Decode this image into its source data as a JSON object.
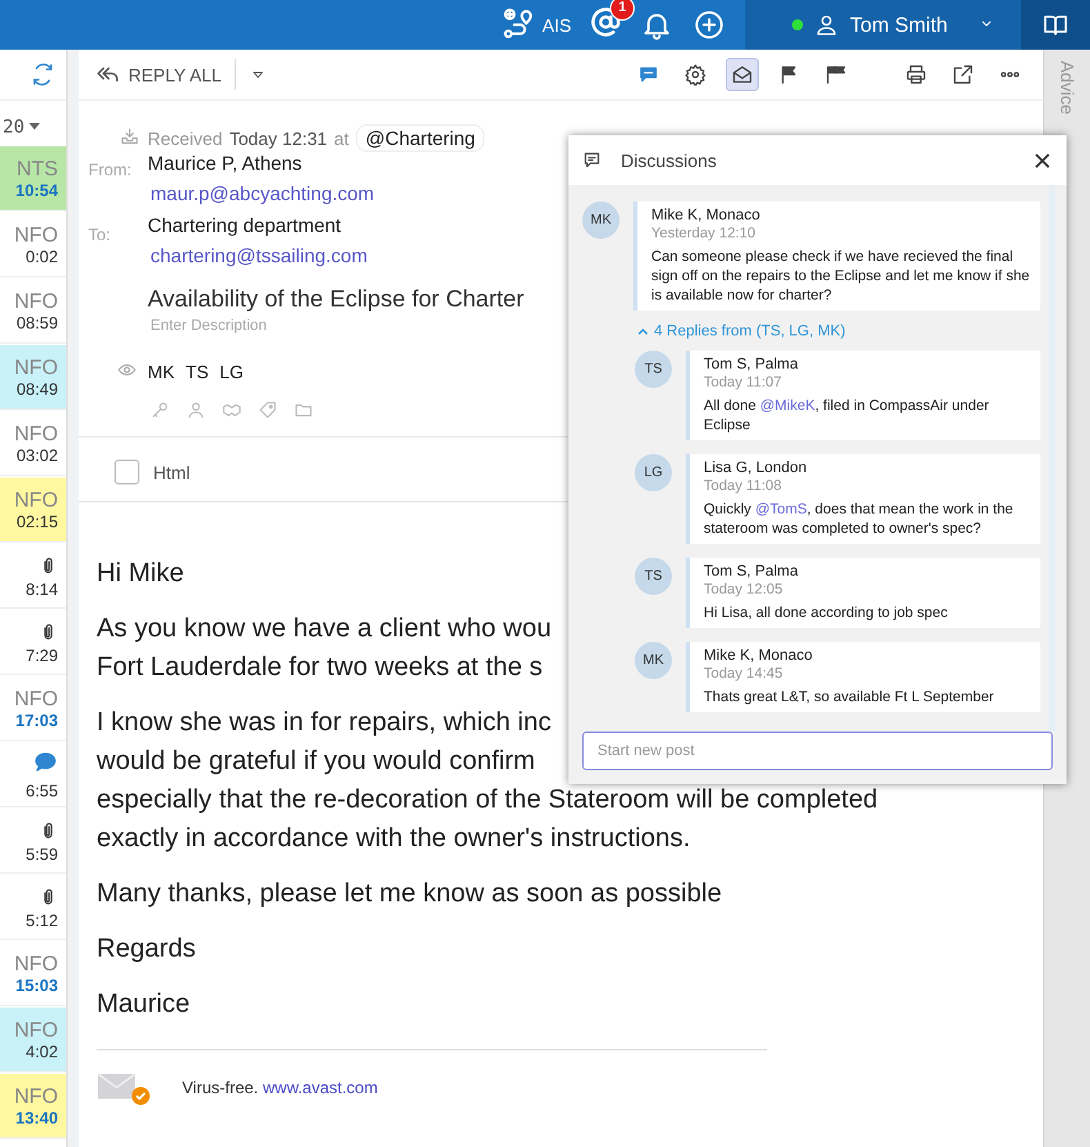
{
  "top_bar": {
    "ais_label": "AIS",
    "mentions_badge": "1",
    "user_name": "Tom Smith",
    "online": true
  },
  "message_list": {
    "year_selector": "20",
    "items": [
      {
        "kind": "label",
        "label": "NTS",
        "time": "10:54",
        "unread": true,
        "color": "#b7e6a6"
      },
      {
        "kind": "label",
        "label": "NFO",
        "time": "0:02",
        "unread": false,
        "color": "#ffffff"
      },
      {
        "kind": "label",
        "label": "NFO",
        "time": "08:59",
        "unread": false,
        "color": "#ffffff"
      },
      {
        "kind": "label",
        "label": "NFO",
        "time": "08:49",
        "unread": false,
        "color": "#c8f1f8"
      },
      {
        "kind": "label",
        "label": "NFO",
        "time": "03:02",
        "unread": false,
        "color": "#ffffff"
      },
      {
        "kind": "label",
        "label": "NFO",
        "time": "02:15",
        "unread": false,
        "color": "#fff8a0"
      },
      {
        "kind": "attachment",
        "time": "8:14",
        "unread": false,
        "color": "#ffffff"
      },
      {
        "kind": "attachment",
        "time": "7:29",
        "unread": false,
        "color": "#ffffff"
      },
      {
        "kind": "label",
        "label": "NFO",
        "time": "17:03",
        "unread": true,
        "color": "#ffffff"
      },
      {
        "kind": "chat",
        "time": "6:55",
        "unread": false,
        "color": "#ffffff"
      },
      {
        "kind": "attachment",
        "time": "5:59",
        "unread": false,
        "color": "#ffffff"
      },
      {
        "kind": "attachment",
        "time": "5:12",
        "unread": false,
        "color": "#ffffff"
      },
      {
        "kind": "label",
        "label": "NFO",
        "time": "15:03",
        "unread": true,
        "color": "#ffffff"
      },
      {
        "kind": "label",
        "label": "NFO",
        "time": "4:02",
        "unread": false,
        "color": "#c8f1f8"
      },
      {
        "kind": "label",
        "label": "NFO",
        "time": "13:40",
        "unread": true,
        "color": "#fff8a0"
      }
    ]
  },
  "toolbar": {
    "reply_all_label": "REPLY ALL",
    "buttons": [
      {
        "kind": "chat",
        "selected": false
      },
      {
        "kind": "settings",
        "selected": false
      },
      {
        "kind": "envelope",
        "selected": true
      },
      {
        "kind": "flag",
        "selected": false
      },
      {
        "kind": "flags",
        "selected": false
      },
      {
        "kind": "print",
        "selected": false
      },
      {
        "kind": "edit",
        "selected": false
      },
      {
        "kind": "more",
        "selected": false
      }
    ]
  },
  "email": {
    "received_label": "Received",
    "received_time": "Today 12:31",
    "at_label": "at",
    "mailbox": "@Chartering",
    "from_label": "From:",
    "from_name": "Maurice P, Athens",
    "from_email": "maur.p@abcyachting.com",
    "to_label": "To:",
    "to_name": "Chartering department",
    "to_email": "chartering@tssailing.com",
    "subject": "Availability of the Eclipse for Charter",
    "description_placeholder": "Enter Description",
    "watchers": [
      "MK",
      "TS",
      "LG"
    ],
    "html_checkbox": {
      "label": "Html",
      "checked": false
    },
    "body_paragraphs": [
      [
        "Hi Mike"
      ],
      [
        "As you know we have a client who wou",
        "Fort Lauderdale for two weeks at the s"
      ],
      [
        "I know she was in for repairs, which inc",
        "would be grateful if you would confirm",
        "especially that the re-decoration of the Stateroom will be completed",
        "exactly in accordance with the owner's instructions."
      ],
      [
        "Many thanks, please let me know as soon as possible"
      ],
      [
        "Regards"
      ],
      [
        "Maurice"
      ]
    ],
    "footer": {
      "text": "Virus-free.",
      "link": "www.avast.com"
    }
  },
  "discussion": {
    "title": "Discussions",
    "new_post_placeholder": "Start new post",
    "posts": [
      {
        "initials": "MK",
        "author": "Mike K, Monaco",
        "time": "Yesterday 12:10",
        "parts": [
          {
            "text": "Can someone please check if we have recieved the final sign off on the repairs to the Eclipse and let me know if she is available now for charter?",
            "mention": false
          }
        ],
        "replies_toggle": "4 Replies from (TS, LG, MK)",
        "expanded": true,
        "replies": [
          {
            "initials": "TS",
            "author": "Tom S, Palma",
            "time": "Today 11:07",
            "parts": [
              {
                "text": "All done ",
                "mention": false
              },
              {
                "text": "@MikeK",
                "mention": true
              },
              {
                "text": ", filed in CompassAir under Eclipse",
                "mention": false
              }
            ]
          },
          {
            "initials": "LG",
            "author": "Lisa G, London",
            "time": "Today 11:08",
            "parts": [
              {
                "text": "Quickly ",
                "mention": false
              },
              {
                "text": "@TomS",
                "mention": true
              },
              {
                "text": ", does that mean the work in the stateroom was completed to owner's spec?",
                "mention": false
              }
            ]
          },
          {
            "initials": "TS",
            "author": "Tom S, Palma",
            "time": "Today 12:05",
            "parts": [
              {
                "text": "Hi Lisa, all done according to job spec",
                "mention": false
              }
            ]
          },
          {
            "initials": "MK",
            "author": "Mike K, Monaco",
            "time": "Today 14:45",
            "parts": [
              {
                "text": "Thats great L&T, so available Ft L September",
                "mention": false
              }
            ]
          }
        ]
      }
    ]
  },
  "side_tab": {
    "label": "Advice"
  }
}
